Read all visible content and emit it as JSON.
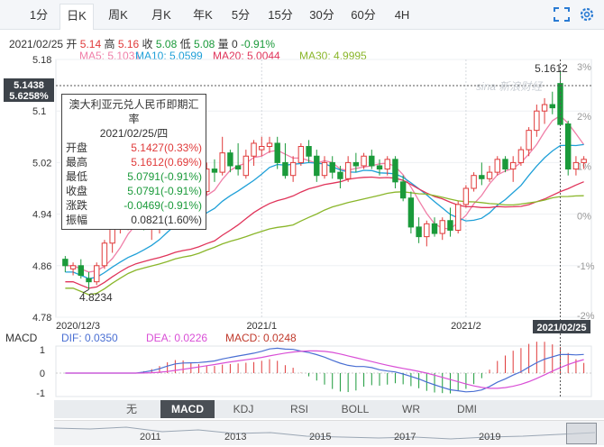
{
  "toolbar": {
    "tabs": [
      {
        "label": "1分"
      },
      {
        "label": "日K"
      },
      {
        "label": "周K"
      },
      {
        "label": "月K"
      },
      {
        "label": "年K"
      },
      {
        "label": "5分"
      },
      {
        "label": "15分"
      },
      {
        "label": "30分"
      },
      {
        "label": "60分"
      },
      {
        "label": "4H"
      }
    ],
    "active_index": 1,
    "icons": [
      "fullscreen-icon",
      "settings-gear-icon"
    ]
  },
  "quote": {
    "date": "2021/02/25",
    "open_label": "开",
    "open": "5.14",
    "high_label": "高",
    "high": "5.16",
    "close_label": "收",
    "close": "5.08",
    "low_label": "低",
    "low": "5.08",
    "volume_label": "量",
    "volume": "0",
    "change_pct": "-0.91%"
  },
  "ma": {
    "ma5": "MA5: 5.1031",
    "ma10": "MA10: 5.0599",
    "ma20": "MA20: 5.0044",
    "ma30": "MA30: 4.9995"
  },
  "colors": {
    "up": "#e03a3a",
    "down": "#1a9a3a",
    "ma5": "#f07fa8",
    "ma10": "#1fa0d8",
    "ma20": "#e0345a",
    "ma30": "#8ab62a"
  },
  "tooltip": {
    "title": "澳大利亚元兑人民币即期汇率",
    "date": "2021/02/25/四",
    "rows": [
      {
        "label": "开盘",
        "value": "5.1427(0.33%)"
      },
      {
        "label": "最高",
        "value": "5.1612(0.69%)"
      },
      {
        "label": "最低",
        "value": "5.0791(-0.91%)"
      },
      {
        "label": "收盘",
        "value": "5.0791(-0.91%)"
      },
      {
        "label": "涨跌",
        "value": "-0.0469(-0.91%)"
      },
      {
        "label": "振幅",
        "value": "0.0821(1.60%)"
      }
    ]
  },
  "crosshair": {
    "price": "5.1438",
    "pct": "5.6258%",
    "date": "2021/02/25"
  },
  "annotations": {
    "max": "5.1612",
    "min": "4.8234"
  },
  "watermark": "sina 新浪财经",
  "chart_data": {
    "type": "candlestick",
    "y_ticks": [
      "5.18",
      "5.1",
      "5.02",
      "4.94",
      "4.86",
      "4.78"
    ],
    "pct_ticks": [
      "3%",
      "2%",
      "1%",
      "0%",
      "-1%",
      "-2%"
    ],
    "x_ticks": [
      "2020/12/3",
      "2021/1",
      "2021/2"
    ],
    "ylim": [
      4.78,
      5.18
    ],
    "candles": [
      {
        "o": 4.87,
        "h": 4.875,
        "l": 4.85,
        "c": 4.86
      },
      {
        "o": 4.855,
        "h": 4.865,
        "l": 4.845,
        "c": 4.86
      },
      {
        "o": 4.86,
        "h": 4.87,
        "l": 4.84,
        "c": 4.845
      },
      {
        "o": 4.84,
        "h": 4.85,
        "l": 4.823,
        "c": 4.835
      },
      {
        "o": 4.835,
        "h": 4.865,
        "l": 4.83,
        "c": 4.86
      },
      {
        "o": 4.86,
        "h": 4.9,
        "l": 4.855,
        "c": 4.895
      },
      {
        "o": 4.895,
        "h": 4.93,
        "l": 4.88,
        "c": 4.92
      },
      {
        "o": 4.92,
        "h": 4.945,
        "l": 4.91,
        "c": 4.93
      },
      {
        "o": 4.93,
        "h": 4.95,
        "l": 4.915,
        "c": 4.94
      },
      {
        "o": 4.94,
        "h": 4.96,
        "l": 4.925,
        "c": 4.935
      },
      {
        "o": 4.935,
        "h": 4.95,
        "l": 4.915,
        "c": 4.925
      },
      {
        "o": 4.925,
        "h": 4.94,
        "l": 4.9,
        "c": 4.93
      },
      {
        "o": 4.93,
        "h": 4.95,
        "l": 4.91,
        "c": 4.935
      },
      {
        "o": 4.935,
        "h": 4.955,
        "l": 4.925,
        "c": 4.95
      },
      {
        "o": 4.95,
        "h": 4.975,
        "l": 4.94,
        "c": 4.965
      },
      {
        "o": 4.965,
        "h": 4.975,
        "l": 4.945,
        "c": 4.95
      },
      {
        "o": 4.95,
        "h": 4.96,
        "l": 4.935,
        "c": 4.945
      },
      {
        "o": 4.945,
        "h": 4.98,
        "l": 4.94,
        "c": 4.975
      },
      {
        "o": 4.975,
        "h": 5.02,
        "l": 4.97,
        "c": 5.01
      },
      {
        "o": 5.01,
        "h": 5.025,
        "l": 4.99,
        "c": 5.005
      },
      {
        "o": 5.005,
        "h": 5.06,
        "l": 5.0,
        "c": 5.035
      },
      {
        "o": 5.035,
        "h": 5.04,
        "l": 5.005,
        "c": 5.015
      },
      {
        "o": 5.015,
        "h": 5.05,
        "l": 5.0,
        "c": 5.01
      },
      {
        "o": 5.0,
        "h": 5.04,
        "l": 4.995,
        "c": 5.03
      },
      {
        "o": 5.03,
        "h": 5.055,
        "l": 5.015,
        "c": 5.05
      },
      {
        "o": 5.04,
        "h": 5.06,
        "l": 5.03,
        "c": 5.045
      },
      {
        "o": 5.045,
        "h": 5.06,
        "l": 5.035,
        "c": 5.05
      },
      {
        "o": 5.05,
        "h": 5.06,
        "l": 5.01,
        "c": 5.02
      },
      {
        "o": 5.02,
        "h": 5.05,
        "l": 4.995,
        "c": 5.0
      },
      {
        "o": 5.0,
        "h": 5.03,
        "l": 4.99,
        "c": 5.02
      },
      {
        "o": 5.02,
        "h": 5.05,
        "l": 5.015,
        "c": 5.045
      },
      {
        "o": 5.045,
        "h": 5.055,
        "l": 5.02,
        "c": 5.03
      },
      {
        "o": 5.03,
        "h": 5.04,
        "l": 4.99,
        "c": 5.0
      },
      {
        "o": 5.0,
        "h": 5.03,
        "l": 4.995,
        "c": 5.02
      },
      {
        "o": 5.02,
        "h": 5.03,
        "l": 4.995,
        "c": 5.005
      },
      {
        "o": 5.005,
        "h": 5.015,
        "l": 4.98,
        "c": 4.995
      },
      {
        "o": 4.995,
        "h": 5.03,
        "l": 4.99,
        "c": 5.02
      },
      {
        "o": 5.02,
        "h": 5.035,
        "l": 5.005,
        "c": 5.015
      },
      {
        "o": 5.015,
        "h": 5.035,
        "l": 5.01,
        "c": 5.03
      },
      {
        "o": 5.03,
        "h": 5.04,
        "l": 5.01,
        "c": 5.015
      },
      {
        "o": 5.015,
        "h": 5.025,
        "l": 5.0,
        "c": 5.01
      },
      {
        "o": 5.01,
        "h": 5.03,
        "l": 5.0,
        "c": 5.025
      },
      {
        "o": 5.025,
        "h": 5.03,
        "l": 4.98,
        "c": 4.99
      },
      {
        "o": 4.99,
        "h": 5.0,
        "l": 4.96,
        "c": 4.965
      },
      {
        "o": 4.965,
        "h": 4.975,
        "l": 4.91,
        "c": 4.92
      },
      {
        "o": 4.92,
        "h": 4.935,
        "l": 4.895,
        "c": 4.905
      },
      {
        "o": 4.905,
        "h": 4.93,
        "l": 4.89,
        "c": 4.925
      },
      {
        "o": 4.925,
        "h": 4.935,
        "l": 4.905,
        "c": 4.91
      },
      {
        "o": 4.91,
        "h": 4.935,
        "l": 4.9,
        "c": 4.93
      },
      {
        "o": 4.93,
        "h": 4.95,
        "l": 4.905,
        "c": 4.915
      },
      {
        "o": 4.915,
        "h": 4.96,
        "l": 4.91,
        "c": 4.955
      },
      {
        "o": 4.955,
        "h": 4.985,
        "l": 4.95,
        "c": 4.98
      },
      {
        "o": 4.98,
        "h": 5.005,
        "l": 4.975,
        "c": 5.0
      },
      {
        "o": 5.0,
        "h": 5.02,
        "l": 4.985,
        "c": 4.995
      },
      {
        "o": 4.995,
        "h": 5.015,
        "l": 4.99,
        "c": 5.005
      },
      {
        "o": 5.005,
        "h": 5.03,
        "l": 5.0,
        "c": 5.025
      },
      {
        "o": 5.025,
        "h": 5.03,
        "l": 5.005,
        "c": 5.01
      },
      {
        "o": 5.01,
        "h": 5.03,
        "l": 4.99,
        "c": 5.02
      },
      {
        "o": 5.02,
        "h": 5.045,
        "l": 5.015,
        "c": 5.04
      },
      {
        "o": 5.04,
        "h": 5.075,
        "l": 5.03,
        "c": 5.07
      },
      {
        "o": 5.07,
        "h": 5.11,
        "l": 5.06,
        "c": 5.1
      },
      {
        "o": 5.1,
        "h": 5.12,
        "l": 5.08,
        "c": 5.11
      },
      {
        "o": 5.11,
        "h": 5.13,
        "l": 5.095,
        "c": 5.105
      },
      {
        "o": 5.1427,
        "h": 5.1612,
        "l": 5.0791,
        "c": 5.0791
      },
      {
        "o": 5.08,
        "h": 5.085,
        "l": 5.0,
        "c": 5.01
      },
      {
        "o": 5.01,
        "h": 5.03,
        "l": 5.0,
        "c": 5.02
      },
      {
        "o": 5.02,
        "h": 5.03,
        "l": 5.01,
        "c": 5.025
      }
    ]
  },
  "macd": {
    "label": "MACD",
    "dif": "DIF: 0.0350",
    "dea": "DEA: 0.0226",
    "macd": "MACD: 0.0248",
    "y_ticks": [
      "1",
      "0",
      "-1"
    ]
  },
  "indicators": {
    "tabs": [
      "无",
      "MACD",
      "KDJ",
      "RSI",
      "BOLL",
      "WR",
      "DMI"
    ],
    "active_index": 1
  },
  "timeline": {
    "years": [
      "2011",
      "2013",
      "2015",
      "2017",
      "2019"
    ]
  }
}
